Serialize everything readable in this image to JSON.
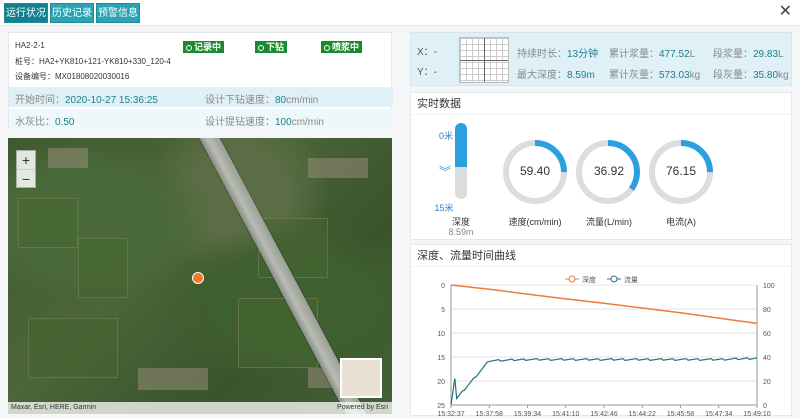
{
  "tabs": [
    {
      "label": "运行状况",
      "active": true
    },
    {
      "label": "历史记录",
      "active": false
    },
    {
      "label": "预警信息",
      "active": false
    }
  ],
  "close_label": "✕",
  "info": {
    "code": "HA2-2-1",
    "pile_line": "桩号：HA2+YK810+121-YK810+330_120-4",
    "device_line": "设备编号：MX01808020030016",
    "statuses": [
      "记录中",
      "下钻",
      "喷浆中"
    ],
    "start_time_label": "开始时间：",
    "start_time_value": "2020-10-27 15:36:25",
    "down_speed_label": "设计下钻速度：",
    "down_speed_value": "80",
    "down_speed_unit": "cm/min",
    "wc_ratio_label": "水灰比：",
    "wc_ratio_value": "0.50",
    "up_speed_label": "设计提钻速度：",
    "up_speed_value": "100",
    "up_speed_unit": "cm/min"
  },
  "map": {
    "zoom_in": "+",
    "zoom_out": "−",
    "attribution": "Maxar, Esri, HERE, Garmin",
    "powered_by": "Powered by Esri"
  },
  "xy": {
    "x_label": "X：-",
    "y_label": "Y：-",
    "duration_label": "持续时长：",
    "duration_value": "13分钟",
    "total_slurry_label": "累计浆量：",
    "total_slurry_value": "477.52",
    "total_slurry_unit": "L",
    "segment_slurry_label": "段浆量：",
    "segment_slurry_value": "29.83",
    "segment_slurry_unit": "L",
    "max_depth_label": "最大深度：",
    "max_depth_value": "8.59m",
    "total_ash_label": "累计灰量：",
    "total_ash_value": "573.03",
    "total_ash_unit": "kg",
    "segment_ash_label": "段灰量：",
    "segment_ash_value": "35.80",
    "segment_ash_unit": "kg"
  },
  "realtime": {
    "title": "实时数据",
    "depth_top": "0米",
    "depth_bottom": "15米",
    "depth_label": "深度",
    "depth_value": "8.59m",
    "depth_fraction": 0.573,
    "chevrons": "︾",
    "dials": [
      {
        "value": "59.40",
        "label": "速度(cm/min)",
        "fraction": 0.25
      },
      {
        "value": "36.92",
        "label": "流量(L/min)",
        "fraction": 0.35
      },
      {
        "value": "76.15",
        "label": "电流(A)",
        "fraction": 0.25
      }
    ],
    "accent": "#2aa0e0"
  },
  "curve": {
    "title": "深度、流量时间曲线",
    "legend_depth": "深度",
    "legend_flow": "流量",
    "depth_color": "#f07a3f",
    "flow_color": "#2b6f80"
  },
  "chart_data": {
    "type": "line",
    "title": "深度、流量时间曲线",
    "x": [
      "15:32:37",
      "15:37:58",
      "15:39:34",
      "15:41:10",
      "15:42:46",
      "15:44:22",
      "15:45:58",
      "15:47:34",
      "15:49:10"
    ],
    "series": [
      {
        "name": "深度",
        "axis": "left",
        "values": [
          0,
          0.9,
          1.9,
          2.9,
          3.8,
          4.8,
          5.8,
          6.9,
          8.0
        ]
      },
      {
        "name": "流量",
        "axis": "right",
        "values": [
          0,
          37,
          38,
          38,
          38,
          38,
          38,
          38,
          39
        ]
      }
    ],
    "y_left": {
      "ticks": [
        "0",
        "5",
        "10",
        "15",
        "20",
        "25"
      ],
      "ylim": [
        0,
        25
      ],
      "inverted": true
    },
    "y_right": {
      "ticks": [
        "100",
        "80",
        "60",
        "40",
        "20",
        "0"
      ],
      "ylim": [
        0,
        100
      ]
    },
    "grid": true,
    "legend": "top-center"
  }
}
